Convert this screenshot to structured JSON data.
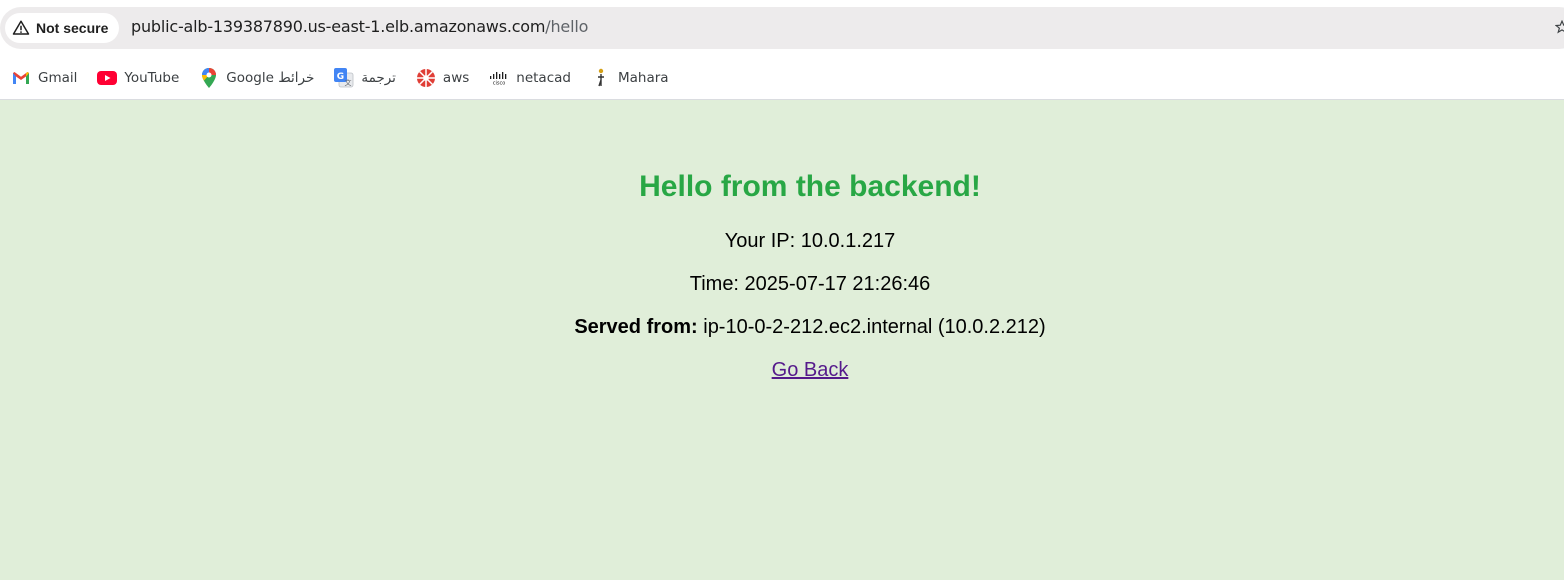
{
  "browser": {
    "security_label": "Not secure",
    "url_host": "public-alb-139387890.us-east-1.elb.amazonaws.com",
    "url_path": "/hello"
  },
  "bookmarks": [
    {
      "label": "Gmail",
      "icon": "gmail-icon"
    },
    {
      "label": "YouTube",
      "icon": "youtube-icon"
    },
    {
      "label": "Google خرائط",
      "icon": "google-maps-icon"
    },
    {
      "label": "ترجمة",
      "icon": "google-translate-icon"
    },
    {
      "label": "aws",
      "icon": "aws-icon"
    },
    {
      "label": "netacad",
      "icon": "cisco-icon"
    },
    {
      "label": "Mahara",
      "icon": "mahara-icon"
    }
  ],
  "page": {
    "background": "#e0eed9",
    "heading": "Hello from the backend!",
    "heading_color": "#28a745",
    "ip_text": "Your IP: 10.0.1.217",
    "time_text": "Time: 2025-07-17 21:26:46",
    "served_label": "Served from:",
    "served_value": " ip-10-0-2-212.ec2.internal (10.0.2.212)",
    "back_link": "Go Back",
    "link_color": "#551a8b"
  }
}
